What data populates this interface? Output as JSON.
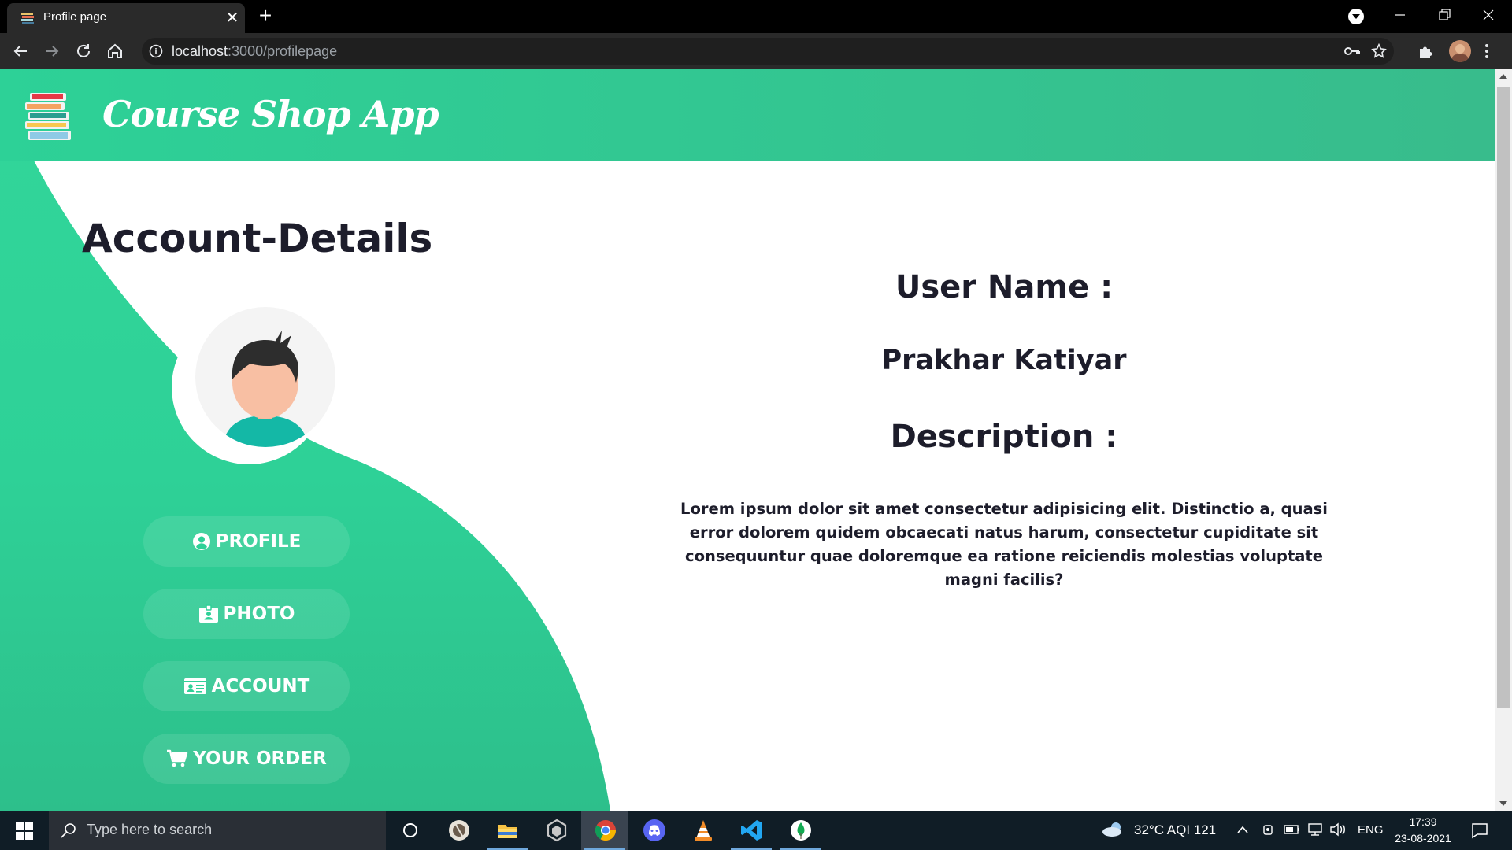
{
  "browser": {
    "tab_title": "Profile page",
    "url_host": "localhost",
    "url_path": ":3000/profilepage"
  },
  "app": {
    "brand": "Course Shop App",
    "page_title": "Account-Details",
    "sidebar": [
      {
        "label": "PROFILE",
        "icon": "user-circle-icon"
      },
      {
        "label": "PHOTO",
        "icon": "id-badge-icon"
      },
      {
        "label": "ACCOUNT",
        "icon": "id-card-icon"
      },
      {
        "label": "YOUR ORDER",
        "icon": "cart-icon"
      }
    ],
    "user_name_label": "User Name :",
    "user_name": "Prakhar Katiyar",
    "description_label": "Description :",
    "description": "Lorem ipsum dolor sit amet consectetur adipisicing elit. Distinctio a, quasi error dolorem quidem obcaecati natus harum, consectetur cupiditate sit consequuntur quae doloremque ea ratione reiciendis molestias voluptate magni facilis?"
  },
  "colors": {
    "primary_green": "#2dd197",
    "header_green": "#38bc8c",
    "text_dark": "#1d1d2b"
  },
  "taskbar": {
    "search_placeholder": "Type here to search",
    "weather": "32°C  AQI 121",
    "language": "ENG",
    "time": "17:39",
    "date": "23-08-2021"
  }
}
